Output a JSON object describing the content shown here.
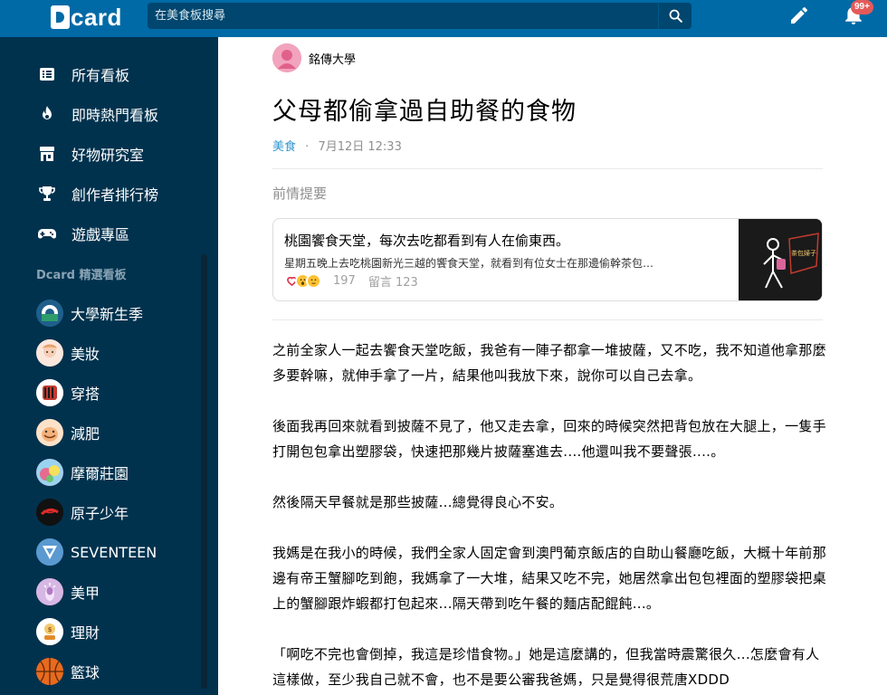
{
  "header": {
    "logo": "card",
    "search_placeholder": "在美食板搜尋",
    "notification_count": "99+"
  },
  "sidebar": {
    "nav": [
      {
        "label": "所有看板",
        "icon": "list-icon"
      },
      {
        "label": "即時熱門看板",
        "icon": "fire-icon"
      },
      {
        "label": "好物研究室",
        "icon": "store-icon"
      },
      {
        "label": "創作者排行榜",
        "icon": "trophy-icon"
      },
      {
        "label": "遊戲專區",
        "icon": "gamepad-icon"
      }
    ],
    "section_title": "Dcard 精選看板",
    "boards": [
      {
        "label": "大學新生季",
        "color": "#1f5f8b"
      },
      {
        "label": "美妝",
        "color": "#f4d6c7"
      },
      {
        "label": "穿搭",
        "color": "#c23a2f"
      },
      {
        "label": "減肥",
        "color": "#f7c9a6"
      },
      {
        "label": "摩爾莊園",
        "color": "#e96a8f"
      },
      {
        "label": "原子少年",
        "color": "#111111"
      },
      {
        "label": "SEVENTEEN",
        "color": "#5a9ad1"
      },
      {
        "label": "美甲",
        "color": "#c8a2d6"
      },
      {
        "label": "理財",
        "color": "#f3c96b"
      },
      {
        "label": "籃球",
        "color": "#e86a1e"
      }
    ]
  },
  "post": {
    "author": "銘傳大學",
    "title": "父母都偷拿過自助餐的食物",
    "board": "美食",
    "separator": "·",
    "time": "7月12日 12:33",
    "prev_label": "前情提要",
    "linked": {
      "title": "桃園饗食天堂，每次去吃都看到有人在偷東西。",
      "excerpt": "星期五晚上去吃桃園新光三越的饗食天堂，就看到有位女士在那邊偷幹茶包…",
      "likes": "197",
      "comments": "留言 123",
      "thumb_text": "茶包婦子"
    },
    "paragraphs": [
      "之前全家人一起去饗食天堂吃飯，我爸有一陣子都拿一堆披薩，又不吃，我不知道他拿那麼多要幹嘛，就伸手拿了一片，結果他叫我放下來，說你可以自己去拿。",
      "後面我再回來就看到披薩不見了，他又走去拿，回來的時候突然把背包放在大腿上，一隻手打開包包拿出塑膠袋，快速把那幾片披薩塞進去....他還叫我不要聲張....。",
      "然後隔天早餐就是那些披薩...總覺得良心不安。",
      "我媽是在我小的時候，我們全家人固定會到澳門葡京飯店的自助山餐廳吃飯，大概十年前那邊有帝王蟹腳吃到飽，我媽拿了一大堆，結果又吃不完，她居然拿出包包裡面的塑膠袋把桌上的蟹腳跟炸蝦都打包起來...隔天帶到吃午餐的麵店配餛飩...。",
      "「啊吃不完也會倒掉，我這是珍惜食物。」她是這麼講的，但我當時震驚很久...怎麼會有人這樣做，至少我自己就不會，也不是要公審我爸媽，只是覺得很荒唐XDDD"
    ]
  }
}
